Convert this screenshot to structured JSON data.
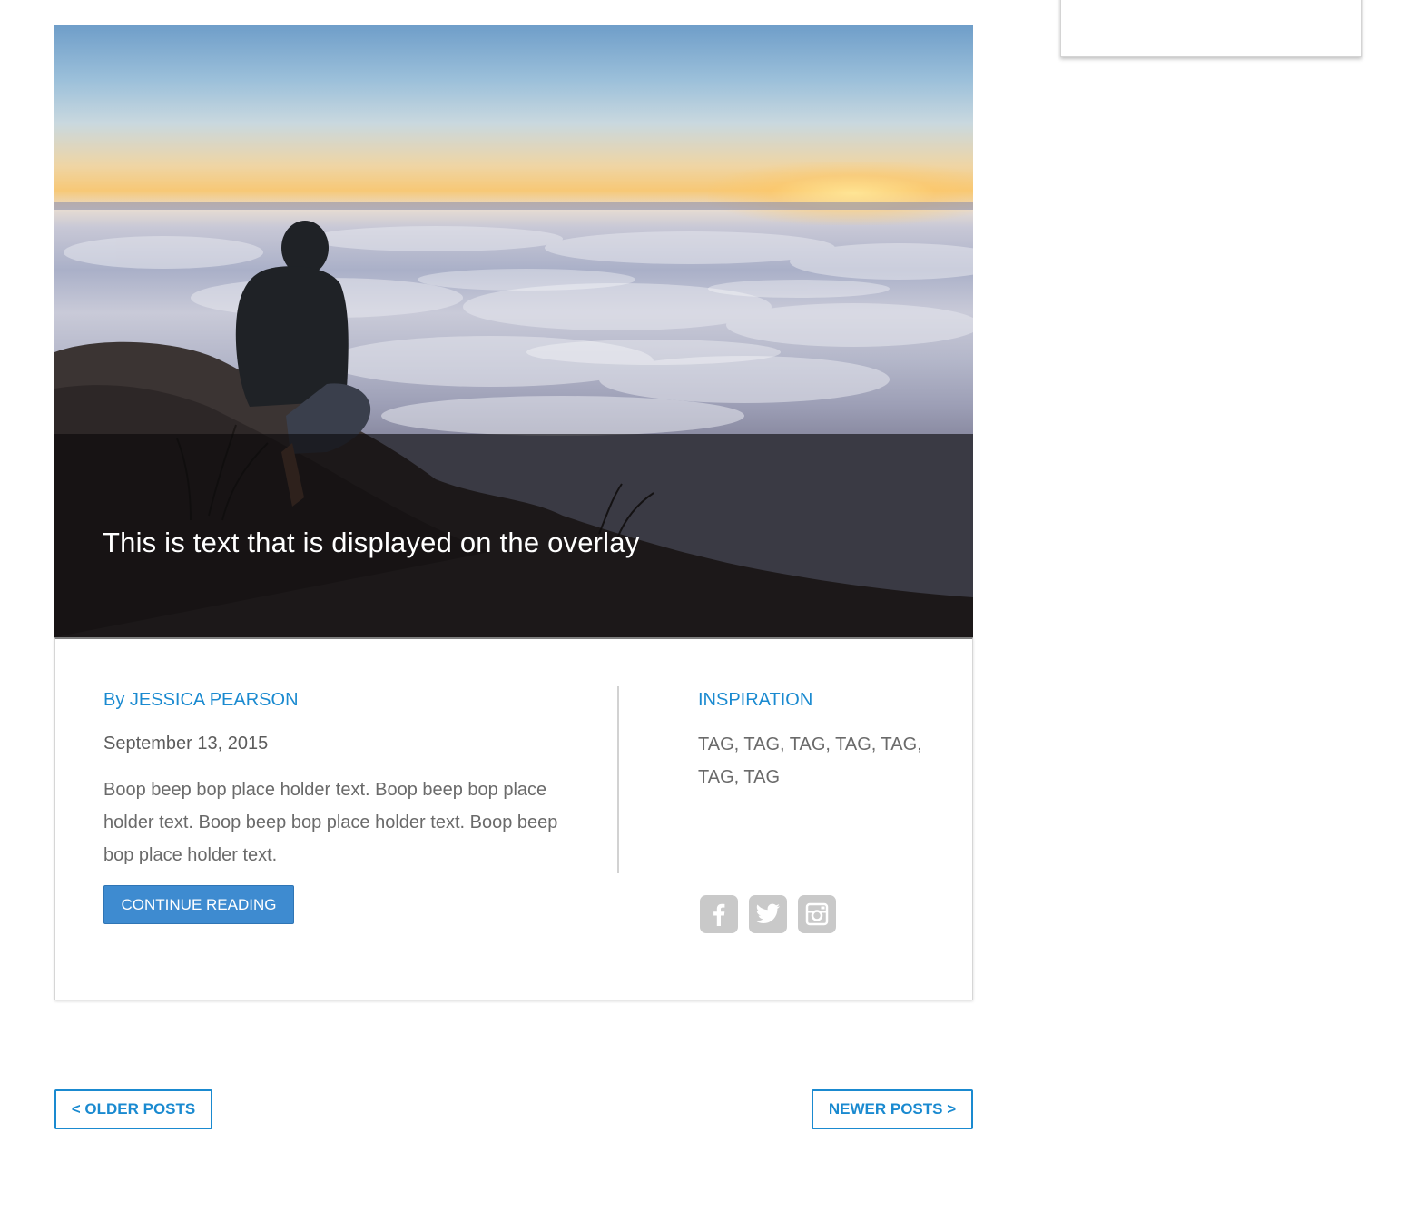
{
  "hero": {
    "overlay_text": "This is text that is displayed on the overlay"
  },
  "post": {
    "author": "By JESSICA PEARSON",
    "date": "September 13, 2015",
    "excerpt": "Boop beep bop place holder text. Boop beep bop place holder text. Boop beep bop place holder text. Boop beep bop place holder text.",
    "continue_label": "CONTINUE READING",
    "category": "INSPIRATION",
    "tags": "TAG, TAG, TAG, TAG, TAG, TAG, TAG",
    "social": [
      {
        "icon": "facebook-icon"
      },
      {
        "icon": "twitter-icon"
      },
      {
        "icon": "instagram-icon"
      }
    ]
  },
  "pagination": {
    "older_label": "< OLDER POSTS",
    "newer_label": "NEWER POSTS >"
  },
  "colors": {
    "accent": "#1a8ad0",
    "button": "#3e8bd0",
    "social_icon_bg": "#c9c9c9"
  }
}
